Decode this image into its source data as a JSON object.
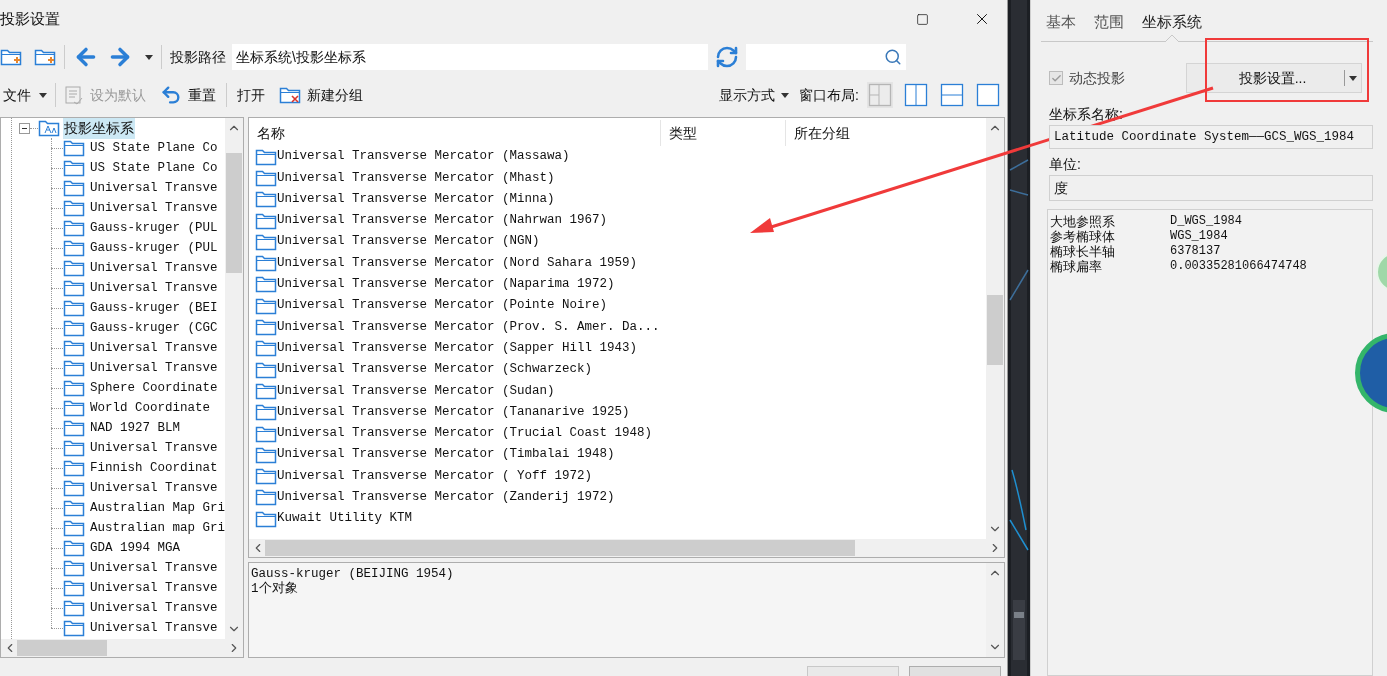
{
  "window": {
    "title": "投影设置"
  },
  "toolbar": {
    "path_label": "投影路径",
    "path_value": "坐标系统\\投影坐标系"
  },
  "command_bar": {
    "file_menu": "文件",
    "set_default": {
      "label": "设为默认",
      "disabled": true
    },
    "reset": "重置",
    "open": "打开",
    "new_group": "新建分组",
    "display_mode": "显示方式",
    "layout_label": "窗口布局:",
    "layout_buttons": [
      {
        "kind": "quad",
        "disabled": true
      },
      {
        "kind": "columns",
        "disabled": false
      },
      {
        "kind": "rows",
        "disabled": false
      },
      {
        "kind": "single",
        "disabled": false
      }
    ]
  },
  "tree": {
    "root": {
      "label": "投影坐标系",
      "expanded": true,
      "selected": true,
      "children": [
        {
          "label": "US State Plane Co"
        },
        {
          "label": "US State Plane Co"
        },
        {
          "label": "Universal Transve"
        },
        {
          "label": "Universal Transve"
        },
        {
          "label": "Gauss-kruger (PUL"
        },
        {
          "label": "Gauss-kruger (PUL"
        },
        {
          "label": "Universal Transve"
        },
        {
          "label": "Universal Transve"
        },
        {
          "label": "Gauss-kruger (BEI"
        },
        {
          "label": "Gauss-kruger (CGC"
        },
        {
          "label": "Universal Transve"
        },
        {
          "label": "Universal Transve"
        },
        {
          "label": "Sphere Coordinate"
        },
        {
          "label": "World Coordinate"
        },
        {
          "label": "NAD 1927 BLM"
        },
        {
          "label": "Universal Transve"
        },
        {
          "label": "Finnish Coordinat"
        },
        {
          "label": "Universal Transve"
        },
        {
          "label": "Australian Map Gri"
        },
        {
          "label": "Australian map Gri"
        },
        {
          "label": "GDA 1994 MGA"
        },
        {
          "label": "Universal Transve"
        },
        {
          "label": "Universal Transve"
        },
        {
          "label": "Universal Transve"
        },
        {
          "label": "Universal Transve"
        }
      ]
    }
  },
  "list": {
    "columns": [
      "名称",
      "类型",
      "所在分组"
    ],
    "rows": [
      {
        "name": "Universal Transverse Mercator (Massawa)"
      },
      {
        "name": "Universal Transverse Mercator (Mhast)"
      },
      {
        "name": "Universal Transverse Mercator (Minna)"
      },
      {
        "name": "Universal Transverse Mercator (Nahrwan 1967)"
      },
      {
        "name": "Universal Transverse Mercator (NGN)"
      },
      {
        "name": "Universal Transverse Mercator (Nord Sahara 1959)"
      },
      {
        "name": "Universal Transverse Mercator (Naparima 1972)"
      },
      {
        "name": "Universal Transverse Mercator (Pointe Noire)"
      },
      {
        "name": "Universal Transverse Mercator (Prov. S. Amer. Da..."
      },
      {
        "name": "Universal Transverse Mercator (Sapper Hill 1943)"
      },
      {
        "name": "Universal Transverse Mercator (Schwarzeck)"
      },
      {
        "name": "Universal Transverse Mercator (Sudan)"
      },
      {
        "name": "Universal Transverse Mercator (Tananarive 1925)"
      },
      {
        "name": "Universal Transverse Mercator (Trucial Coast 1948)"
      },
      {
        "name": "Universal Transverse Mercator (Timbalai 1948)"
      },
      {
        "name": "Universal Transverse Mercator ( Yoff 1972)"
      },
      {
        "name": "Universal Transverse Mercator (Zanderij 1972)"
      },
      {
        "name": "Kuwait Utility KTM"
      }
    ]
  },
  "info": {
    "lines": [
      "Gauss-kruger (BEIJING 1954)",
      "1个对象"
    ]
  },
  "properties_panel": {
    "tabs": [
      {
        "label": "基本",
        "selected": false
      },
      {
        "label": "范围",
        "selected": false
      },
      {
        "label": "坐标系统",
        "selected": true
      }
    ],
    "dynamic_projection": {
      "label": "动态投影",
      "checked": true,
      "disabled": true
    },
    "projection_button": "投影设置...",
    "name_label": "坐标系名称:",
    "name_value": "Latitude Coordinate System——GCS_WGS_1984",
    "unit_label": "单位:",
    "unit_value": "度",
    "properties": [
      {
        "key": "大地参照系",
        "value": "D_WGS_1984"
      },
      {
        "key": "参考椭球体",
        "value": "WGS_1984"
      },
      {
        "key": "椭球长半轴",
        "value": "6378137"
      },
      {
        "key": "椭球扁率",
        "value": "0.00335281066474748"
      }
    ]
  }
}
